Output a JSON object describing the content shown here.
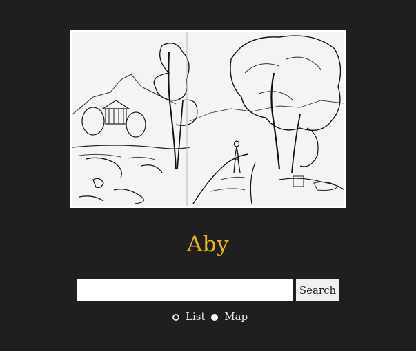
{
  "site": {
    "title": "Aby"
  },
  "hero": {
    "icon": "landscape-sketch"
  },
  "search": {
    "value": "",
    "placeholder": "",
    "button_label": "Search"
  },
  "view_toggle": {
    "options": [
      {
        "label": "List",
        "selected": false
      },
      {
        "label": "Map",
        "selected": true
      }
    ]
  },
  "colors": {
    "background": "#1f1f1f",
    "title": "#e8b416",
    "text": "#e9e9e9"
  }
}
